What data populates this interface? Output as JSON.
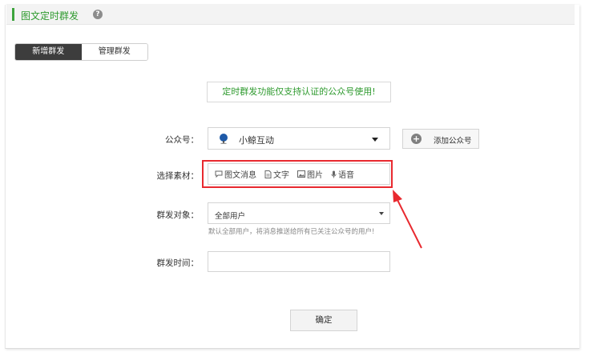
{
  "header": {
    "title": "图文定时群发",
    "help": "?"
  },
  "tabs": [
    {
      "label": "新增群发",
      "active": true
    },
    {
      "label": "管理群发",
      "active": false
    }
  ],
  "notice": "定时群发功能仅支持认证的公众号使用!",
  "form": {
    "account": {
      "label": "公众号：",
      "value": "小鲸互动",
      "icon": "account-avatar-icon"
    },
    "add_account": {
      "label": "添加公众号",
      "icon": "plus-circle-icon"
    },
    "material": {
      "label": "选择素材：",
      "options": [
        {
          "label": "图文消息",
          "icon": "chat-bubble-icon"
        },
        {
          "label": "文字",
          "icon": "document-icon"
        },
        {
          "label": "图片",
          "icon": "image-icon"
        },
        {
          "label": "语音",
          "icon": "microphone-icon"
        }
      ]
    },
    "target": {
      "label": "群发对象：",
      "value": "全部用户",
      "hint": "默认全部用户，将消息推送给所有已关注公众号的用户!"
    },
    "time": {
      "label": "群发时间：",
      "value": ""
    },
    "confirm": "确定"
  },
  "colors": {
    "accent": "#2e9a2e",
    "highlight": "#e8292f",
    "tab_active_bg": "#3d3d3d"
  }
}
